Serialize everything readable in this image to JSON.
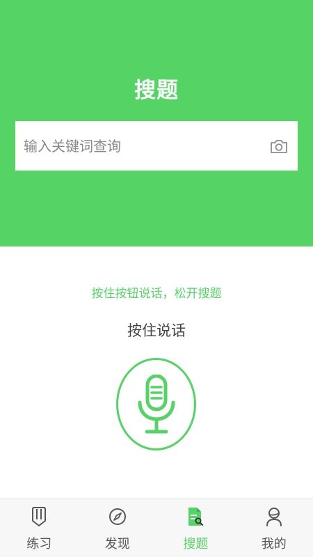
{
  "colors": {
    "accent": "#55d365",
    "header_bg": "#55d365",
    "tab_inactive": "#555555",
    "icon_gray": "#666666"
  },
  "header": {
    "title": "搜题"
  },
  "search": {
    "placeholder": "输入关键词查询",
    "value": "",
    "camera_icon": "camera-icon"
  },
  "voice": {
    "hint": "按住按钮说话，松开搜题",
    "label": "按住说话",
    "mic_icon": "microphone-icon"
  },
  "tabs": [
    {
      "label": "练习",
      "icon": "practice-icon",
      "active": false
    },
    {
      "label": "发现",
      "icon": "compass-icon",
      "active": false
    },
    {
      "label": "搜题",
      "icon": "search-question-icon",
      "active": true
    },
    {
      "label": "我的",
      "icon": "user-icon",
      "active": false
    }
  ]
}
